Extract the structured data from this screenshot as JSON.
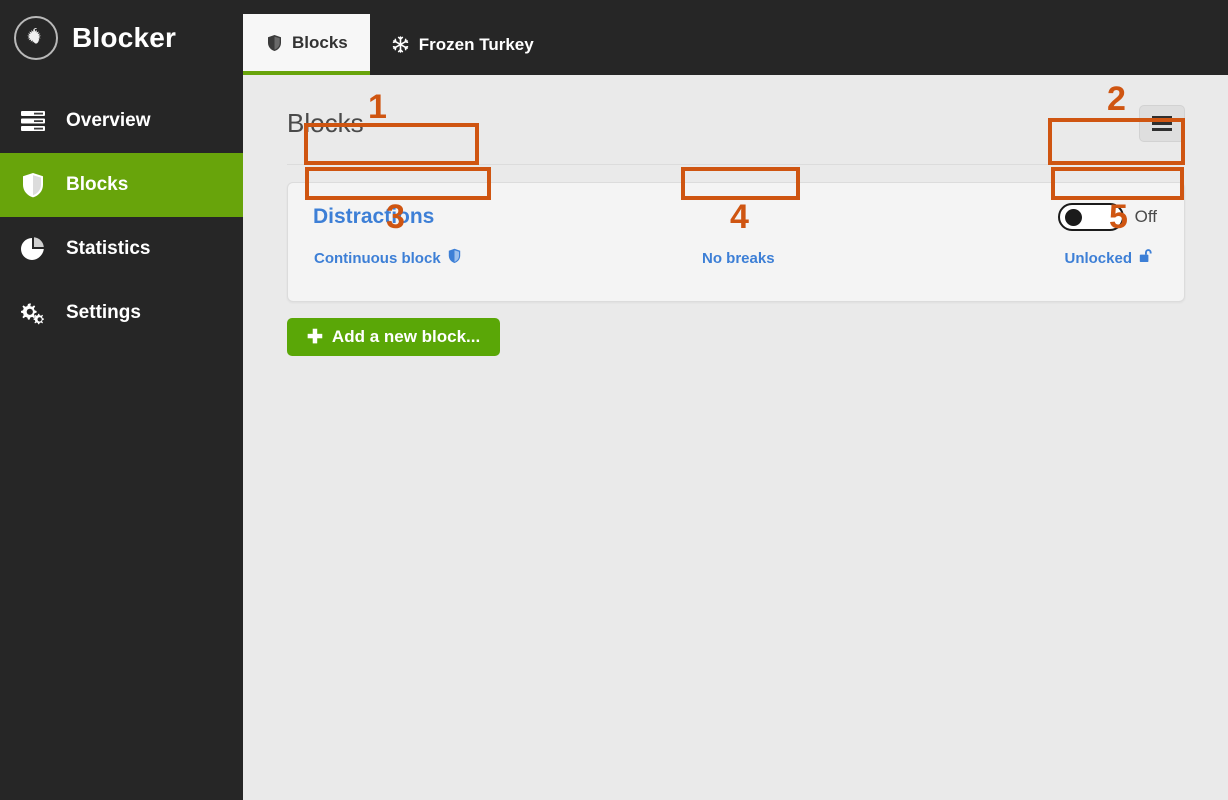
{
  "brand": {
    "name": "Blocker",
    "logo_icon": "turkey-emblem-icon"
  },
  "sidebar": {
    "items": [
      {
        "label": "Overview",
        "icon": "list-lines-icon",
        "active": false
      },
      {
        "label": "Blocks",
        "icon": "shield-icon",
        "active": true
      },
      {
        "label": "Statistics",
        "icon": "pie-chart-icon",
        "active": false
      },
      {
        "label": "Settings",
        "icon": "gears-icon",
        "active": false
      }
    ]
  },
  "tabs": [
    {
      "label": "Blocks",
      "icon": "shield-icon",
      "active": true
    },
    {
      "label": "Frozen Turkey",
      "icon": "snowflake-icon",
      "active": false
    }
  ],
  "page": {
    "title": "Blocks",
    "menu_icon": "hamburger-icon"
  },
  "block": {
    "name": "Distractions",
    "schedule_label": "Continuous block",
    "schedule_icon": "shield-icon",
    "breaks_label": "No breaks",
    "lock_label": "Unlocked",
    "lock_icon": "unlock-icon",
    "toggle_state_label": "Off",
    "toggle_on": false
  },
  "actions": {
    "add_block_label": "Add a new block...",
    "add_block_icon": "plus-icon"
  },
  "annotations": [
    {
      "number": "1",
      "target": "block-name"
    },
    {
      "number": "2",
      "target": "enable-toggle"
    },
    {
      "number": "3",
      "target": "schedule-link"
    },
    {
      "number": "4",
      "target": "breaks-link"
    },
    {
      "number": "5",
      "target": "lock-link"
    }
  ],
  "colors": {
    "accent_green": "#68a40b",
    "button_green": "#5aa707",
    "link_blue": "#3d7fd6",
    "annotation_orange": "#cf5511",
    "sidebar_dark": "#262626",
    "page_bg": "#eaeaea"
  }
}
